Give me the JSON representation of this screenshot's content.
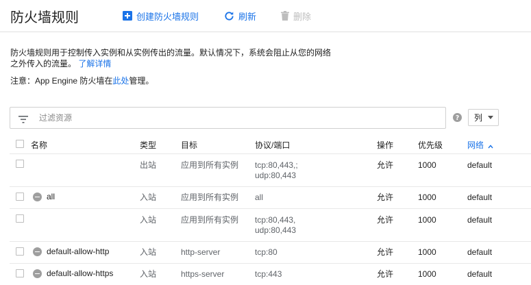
{
  "header": {
    "title": "防火墙规则",
    "create_label": "创建防火墙规则",
    "refresh_label": "刷新",
    "delete_label": "删除"
  },
  "description": {
    "text": "防火墙规则用于控制传入实例和从实例传出的流量。默认情况下，系统会阻止从您的网络之外传入的流量。",
    "link": "了解详情"
  },
  "note": {
    "prefix": "注意：App Engine 防火墙在",
    "link": "此处",
    "suffix": "管理。"
  },
  "filter": {
    "placeholder": "过滤资源"
  },
  "columns_button": "列",
  "table": {
    "headers": {
      "name": "名称",
      "type": "类型",
      "target": "目标",
      "protocol": "协议/端口",
      "action": "操作",
      "priority": "优先级",
      "network": "网络"
    },
    "sort_indicator": "^",
    "rows": [
      {
        "name": "",
        "type": "出站",
        "target": "应用到所有实例",
        "protocol_1": "tcp:80,443,;",
        "protocol_2": "udp:80,443",
        "action": "允许",
        "priority": "1000",
        "network": "default"
      },
      {
        "name": "all",
        "type": "入站",
        "target": "应用到所有实例",
        "protocol_1": "all",
        "protocol_2": "",
        "action": "允许",
        "priority": "1000",
        "network": "default"
      },
      {
        "name": "",
        "type": "入站",
        "target": "应用到所有实例",
        "protocol_1": "tcp:80,443,",
        "protocol_2": "udp:80,443",
        "action": "允许",
        "priority": "1000",
        "network": "default"
      },
      {
        "name": "default-allow-http",
        "type": "入站",
        "target": "http-server",
        "protocol_1": "tcp:80",
        "protocol_2": "",
        "action": "允许",
        "priority": "1000",
        "network": "default"
      },
      {
        "name": "default-allow-https",
        "type": "入站",
        "target": "https-server",
        "protocol_1": "tcp:443",
        "protocol_2": "",
        "action": "允许",
        "priority": "1000",
        "network": "default"
      }
    ]
  },
  "colors": {
    "accent": "#1a73e8",
    "disabled": "#bdbdbd",
    "status_disabled": "#9e9e9e"
  }
}
